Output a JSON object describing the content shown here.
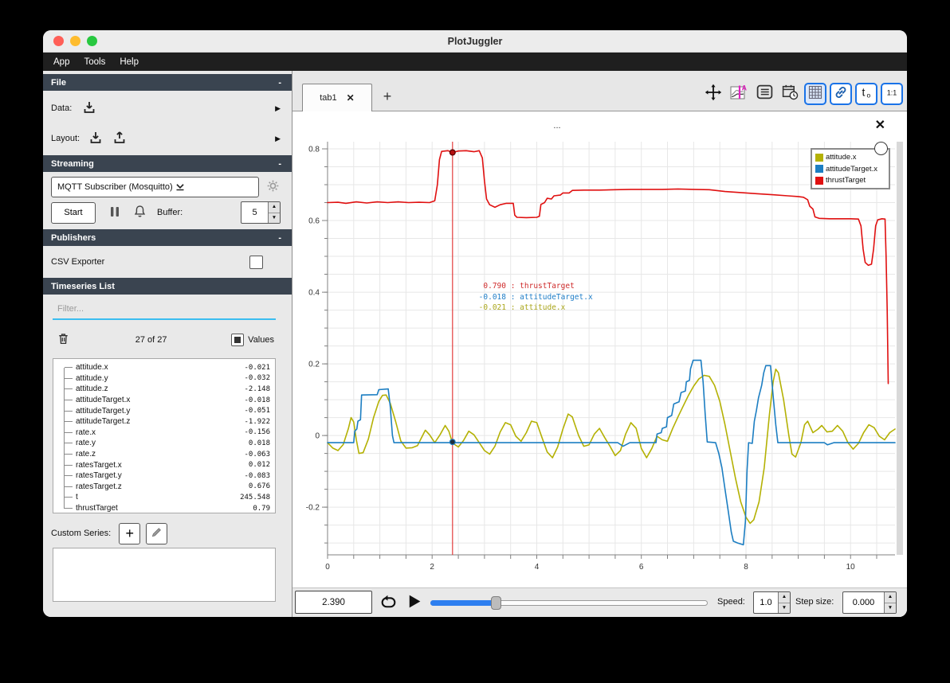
{
  "window": {
    "title": "PlotJuggler"
  },
  "menu": {
    "items": [
      "App",
      "Tools",
      "Help"
    ]
  },
  "sidebar": {
    "file": {
      "title": "File",
      "collapse": "-",
      "data_label": "Data:",
      "layout_label": "Layout:"
    },
    "streaming": {
      "title": "Streaming",
      "collapse": "-",
      "combo_value": "MQTT Subscriber (Mosquitto)",
      "start_label": "Start",
      "buffer_label": "Buffer:",
      "buffer_value": "5"
    },
    "publishers": {
      "title": "Publishers",
      "collapse": "-",
      "csv_label": "CSV Exporter"
    },
    "timeseries": {
      "title": "Timeseries List",
      "filter_placeholder": "Filter...",
      "count": "27 of 27",
      "values_label": "Values",
      "items": [
        {
          "name": "attitude.x",
          "value": "-0.021"
        },
        {
          "name": "attitude.y",
          "value": "-0.032"
        },
        {
          "name": "attitude.z",
          "value": "-2.148"
        },
        {
          "name": "attitudeTarget.x",
          "value": "-0.018"
        },
        {
          "name": "attitudeTarget.y",
          "value": "-0.051"
        },
        {
          "name": "attitudeTarget.z",
          "value": "-1.922"
        },
        {
          "name": "rate.x",
          "value": "-0.156"
        },
        {
          "name": "rate.y",
          "value": "0.018"
        },
        {
          "name": "rate.z",
          "value": "-0.063"
        },
        {
          "name": "ratesTarget.x",
          "value": "0.012"
        },
        {
          "name": "ratesTarget.y",
          "value": "-0.083"
        },
        {
          "name": "ratesTarget.z",
          "value": "0.676"
        },
        {
          "name": "t",
          "value": "245.548"
        },
        {
          "name": "thrustTarget",
          "value": "0.79"
        }
      ]
    },
    "custom_series_label": "Custom Series:"
  },
  "tabs": {
    "active_label": "tab1",
    "close_glyph": "✕",
    "add_glyph": "+"
  },
  "plot": {
    "title": "...",
    "close_glyph": "✕"
  },
  "controls": {
    "time_value": "2.390",
    "speed_label": "Speed:",
    "speed_value": "1.0",
    "step_label": "Step size:",
    "step_value": "0.000",
    "slider_fraction": 0.235
  },
  "chart_data": {
    "type": "line",
    "title": "...",
    "xlim": [
      0,
      10.85
    ],
    "ylim": [
      -0.333,
      0.82
    ],
    "x_ticks": [
      0,
      2,
      4,
      6,
      8,
      10
    ],
    "x_minor_step": 0.5,
    "y_ticks": [
      0.8,
      0.6,
      0.4,
      0.2,
      0,
      -0.2
    ],
    "y_tick_labels": [
      "0.8",
      "0.6",
      "0.4",
      "0.2",
      "0",
      "-0.2"
    ],
    "y_minor_step": 0.05,
    "grid": true,
    "legend_position": "top-right",
    "tracker": {
      "t": 2.39,
      "readouts": [
        {
          "value": "0.790",
          "name": "thrustTarget",
          "color": "#cf2b2b"
        },
        {
          "value": "-0.018",
          "name": "attitudeTarget.x",
          "color": "#1f7ec8"
        },
        {
          "value": "-0.021",
          "name": "attitude.x",
          "color": "#aaa61a"
        }
      ],
      "dots": [
        {
          "series": "thrustTarget",
          "v": 0.79,
          "fill": "#b30f0f",
          "stroke": "#550000"
        },
        {
          "series": "attitudeTarget.x",
          "v": -0.018,
          "fill": "#1d2e3a",
          "stroke": "#1c7ec2"
        }
      ]
    },
    "series": [
      {
        "name": "attitude.x",
        "color": "#b4b104",
        "points": [
          [
            0,
            -0.02
          ],
          [
            0.1,
            -0.035
          ],
          [
            0.2,
            -0.042
          ],
          [
            0.3,
            -0.025
          ],
          [
            0.4,
            0.02
          ],
          [
            0.45,
            0.05
          ],
          [
            0.5,
            0.038
          ],
          [
            0.55,
            -0.012
          ],
          [
            0.6,
            -0.05
          ],
          [
            0.68,
            -0.048
          ],
          [
            0.78,
            -0.01
          ],
          [
            0.88,
            0.05
          ],
          [
            0.98,
            0.095
          ],
          [
            1.05,
            0.112
          ],
          [
            1.12,
            0.113
          ],
          [
            1.2,
            0.09
          ],
          [
            1.3,
            0.04
          ],
          [
            1.4,
            -0.015
          ],
          [
            1.5,
            -0.035
          ],
          [
            1.62,
            -0.034
          ],
          [
            1.72,
            -0.028
          ],
          [
            1.8,
            -0.005
          ],
          [
            1.87,
            0.015
          ],
          [
            1.95,
            0.002
          ],
          [
            2.05,
            -0.02
          ],
          [
            2.15,
            0.002
          ],
          [
            2.25,
            0.028
          ],
          [
            2.32,
            0.012
          ],
          [
            2.39,
            -0.021
          ],
          [
            2.5,
            -0.032
          ],
          [
            2.6,
            -0.014
          ],
          [
            2.7,
            0.012
          ],
          [
            2.8,
            0.002
          ],
          [
            2.9,
            -0.02
          ],
          [
            3.0,
            -0.042
          ],
          [
            3.1,
            -0.052
          ],
          [
            3.2,
            -0.03
          ],
          [
            3.3,
            0.01
          ],
          [
            3.4,
            0.036
          ],
          [
            3.5,
            0.03
          ],
          [
            3.6,
            -0.002
          ],
          [
            3.7,
            -0.016
          ],
          [
            3.8,
            0.008
          ],
          [
            3.9,
            0.04
          ],
          [
            4.0,
            0.036
          ],
          [
            4.1,
            -0.006
          ],
          [
            4.2,
            -0.046
          ],
          [
            4.3,
            -0.062
          ],
          [
            4.4,
            -0.032
          ],
          [
            4.5,
            0.018
          ],
          [
            4.6,
            0.06
          ],
          [
            4.68,
            0.052
          ],
          [
            4.8,
            0.0
          ],
          [
            4.9,
            -0.03
          ],
          [
            5.0,
            -0.026
          ],
          [
            5.1,
            0.004
          ],
          [
            5.2,
            0.02
          ],
          [
            5.3,
            -0.006
          ],
          [
            5.4,
            -0.03
          ],
          [
            5.5,
            -0.056
          ],
          [
            5.6,
            -0.042
          ],
          [
            5.7,
            0.004
          ],
          [
            5.8,
            0.036
          ],
          [
            5.9,
            0.02
          ],
          [
            6.0,
            -0.036
          ],
          [
            6.1,
            -0.062
          ],
          [
            6.2,
            -0.036
          ],
          [
            6.3,
            -0.002
          ],
          [
            6.4,
            -0.012
          ],
          [
            6.5,
            -0.016
          ],
          [
            6.6,
            0.02
          ],
          [
            6.7,
            0.052
          ],
          [
            6.8,
            0.082
          ],
          [
            6.9,
            0.112
          ],
          [
            7.0,
            0.138
          ],
          [
            7.1,
            0.158
          ],
          [
            7.2,
            0.168
          ],
          [
            7.3,
            0.165
          ],
          [
            7.4,
            0.14
          ],
          [
            7.5,
            0.095
          ],
          [
            7.6,
            0.03
          ],
          [
            7.7,
            -0.045
          ],
          [
            7.8,
            -0.12
          ],
          [
            7.9,
            -0.185
          ],
          [
            8.0,
            -0.228
          ],
          [
            8.08,
            -0.245
          ],
          [
            8.15,
            -0.235
          ],
          [
            8.25,
            -0.185
          ],
          [
            8.35,
            -0.09
          ],
          [
            8.45,
            0.06
          ],
          [
            8.52,
            0.15
          ],
          [
            8.57,
            0.185
          ],
          [
            8.62,
            0.175
          ],
          [
            8.72,
            0.1
          ],
          [
            8.82,
            0.0
          ],
          [
            8.88,
            -0.052
          ],
          [
            8.95,
            -0.06
          ],
          [
            9.05,
            -0.02
          ],
          [
            9.12,
            0.03
          ],
          [
            9.18,
            0.04
          ],
          [
            9.28,
            0.008
          ],
          [
            9.38,
            0.018
          ],
          [
            9.45,
            0.028
          ],
          [
            9.55,
            0.01
          ],
          [
            9.65,
            0.012
          ],
          [
            9.75,
            0.028
          ],
          [
            9.85,
            0.012
          ],
          [
            9.95,
            -0.02
          ],
          [
            10.05,
            -0.038
          ],
          [
            10.15,
            -0.022
          ],
          [
            10.25,
            0.008
          ],
          [
            10.35,
            0.03
          ],
          [
            10.45,
            0.022
          ],
          [
            10.55,
            -0.002
          ],
          [
            10.65,
            -0.012
          ],
          [
            10.75,
            0.008
          ],
          [
            10.85,
            0.018
          ]
        ]
      },
      {
        "name": "attitudeTarget.x",
        "color": "#1c7ec2",
        "points": [
          [
            0,
            -0.02
          ],
          [
            0.5,
            -0.02
          ],
          [
            0.52,
            0.012
          ],
          [
            0.56,
            0.018
          ],
          [
            0.58,
            0.04
          ],
          [
            0.63,
            0.044
          ],
          [
            0.65,
            0.113
          ],
          [
            0.95,
            0.114
          ],
          [
            0.98,
            0.128
          ],
          [
            1.16,
            0.13
          ],
          [
            1.2,
            0.08
          ],
          [
            1.24,
            0.0
          ],
          [
            1.27,
            -0.02
          ],
          [
            2.5,
            -0.02
          ],
          [
            4.0,
            -0.02
          ],
          [
            5.55,
            -0.02
          ],
          [
            5.65,
            -0.03
          ],
          [
            5.78,
            -0.02
          ],
          [
            6.28,
            -0.02
          ],
          [
            6.3,
            0.004
          ],
          [
            6.38,
            0.008
          ],
          [
            6.4,
            0.02
          ],
          [
            6.48,
            0.024
          ],
          [
            6.5,
            0.05
          ],
          [
            6.58,
            0.056
          ],
          [
            6.62,
            0.088
          ],
          [
            6.72,
            0.094
          ],
          [
            6.76,
            0.12
          ],
          [
            6.84,
            0.124
          ],
          [
            6.86,
            0.15
          ],
          [
            6.92,
            0.154
          ],
          [
            6.94,
            0.186
          ],
          [
            6.99,
            0.21
          ],
          [
            7.14,
            0.21
          ],
          [
            7.18,
            0.15
          ],
          [
            7.22,
            0.06
          ],
          [
            7.26,
            -0.018
          ],
          [
            7.42,
            -0.02
          ],
          [
            7.48,
            -0.05
          ],
          [
            7.54,
            -0.09
          ],
          [
            7.6,
            -0.15
          ],
          [
            7.66,
            -0.21
          ],
          [
            7.72,
            -0.27
          ],
          [
            7.76,
            -0.295
          ],
          [
            7.84,
            -0.3
          ],
          [
            7.95,
            -0.305
          ],
          [
            7.99,
            -0.24
          ],
          [
            8.02,
            -0.1
          ],
          [
            8.05,
            -0.02
          ],
          [
            8.12,
            -0.022
          ],
          [
            8.16,
            0.04
          ],
          [
            8.2,
            0.07
          ],
          [
            8.24,
            0.105
          ],
          [
            8.3,
            0.14
          ],
          [
            8.34,
            0.175
          ],
          [
            8.38,
            0.195
          ],
          [
            8.47,
            0.195
          ],
          [
            8.52,
            0.11
          ],
          [
            8.57,
            0.03
          ],
          [
            8.61,
            -0.02
          ],
          [
            9.5,
            -0.02
          ],
          [
            9.56,
            -0.026
          ],
          [
            9.68,
            -0.02
          ],
          [
            10.85,
            -0.02
          ]
        ]
      },
      {
        "name": "thrustTarget",
        "color": "#e01010",
        "points": [
          [
            0,
            0.65
          ],
          [
            0.2,
            0.651
          ],
          [
            0.35,
            0.648
          ],
          [
            0.55,
            0.652
          ],
          [
            0.75,
            0.649
          ],
          [
            0.95,
            0.652
          ],
          [
            1.15,
            0.65
          ],
          [
            1.35,
            0.652
          ],
          [
            1.55,
            0.65
          ],
          [
            1.75,
            0.651
          ],
          [
            1.95,
            0.65
          ],
          [
            2.05,
            0.655
          ],
          [
            2.1,
            0.7
          ],
          [
            2.14,
            0.77
          ],
          [
            2.18,
            0.793
          ],
          [
            2.3,
            0.795
          ],
          [
            2.39,
            0.79
          ],
          [
            2.5,
            0.794
          ],
          [
            2.65,
            0.795
          ],
          [
            2.8,
            0.792
          ],
          [
            2.9,
            0.795
          ],
          [
            2.96,
            0.775
          ],
          [
            3.0,
            0.71
          ],
          [
            3.04,
            0.66
          ],
          [
            3.1,
            0.644
          ],
          [
            3.2,
            0.637
          ],
          [
            3.3,
            0.644
          ],
          [
            3.42,
            0.648
          ],
          [
            3.55,
            0.648
          ],
          [
            3.58,
            0.615
          ],
          [
            3.62,
            0.609
          ],
          [
            3.8,
            0.608
          ],
          [
            4.0,
            0.609
          ],
          [
            4.05,
            0.612
          ],
          [
            4.08,
            0.645
          ],
          [
            4.15,
            0.65
          ],
          [
            4.2,
            0.662
          ],
          [
            4.28,
            0.66
          ],
          [
            4.33,
            0.669
          ],
          [
            4.45,
            0.671
          ],
          [
            4.5,
            0.677
          ],
          [
            4.62,
            0.677
          ],
          [
            4.68,
            0.684
          ],
          [
            4.9,
            0.685
          ],
          [
            5.2,
            0.685
          ],
          [
            5.5,
            0.686
          ],
          [
            5.8,
            0.687
          ],
          [
            6.1,
            0.687
          ],
          [
            6.4,
            0.687
          ],
          [
            6.7,
            0.688
          ],
          [
            7.0,
            0.687
          ],
          [
            7.3,
            0.686
          ],
          [
            7.6,
            0.681
          ],
          [
            7.9,
            0.678
          ],
          [
            8.2,
            0.675
          ],
          [
            8.5,
            0.672
          ],
          [
            8.8,
            0.669
          ],
          [
            9.0,
            0.667
          ],
          [
            9.1,
            0.665
          ],
          [
            9.18,
            0.658
          ],
          [
            9.22,
            0.64
          ],
          [
            9.28,
            0.632
          ],
          [
            9.32,
            0.61
          ],
          [
            9.4,
            0.606
          ],
          [
            9.6,
            0.605
          ],
          [
            9.8,
            0.605
          ],
          [
            10.0,
            0.605
          ],
          [
            10.15,
            0.604
          ],
          [
            10.2,
            0.585
          ],
          [
            10.24,
            0.52
          ],
          [
            10.28,
            0.483
          ],
          [
            10.34,
            0.475
          ],
          [
            10.4,
            0.478
          ],
          [
            10.44,
            0.52
          ],
          [
            10.48,
            0.585
          ],
          [
            10.52,
            0.602
          ],
          [
            10.6,
            0.605
          ],
          [
            10.66,
            0.604
          ],
          [
            10.68,
            0.5
          ],
          [
            10.7,
            0.35
          ],
          [
            10.72,
            0.145
          ]
        ]
      }
    ]
  }
}
